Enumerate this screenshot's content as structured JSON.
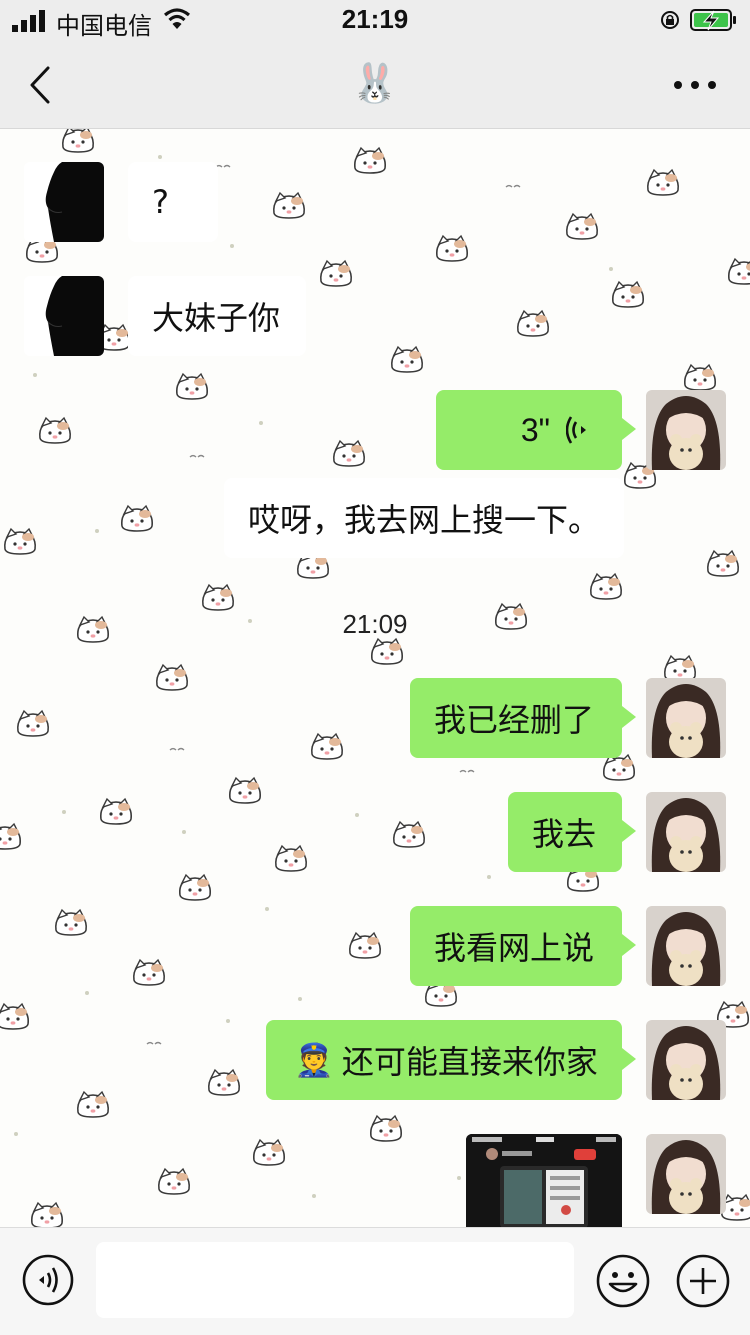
{
  "status_bar": {
    "carrier": "中国电信",
    "time": "21:19"
  },
  "nav": {
    "title": "🐰"
  },
  "messages": {
    "m1": "?",
    "m2": "大妹子你",
    "m3_voice": "3\"",
    "m4": "哎呀，我去网上搜一下。",
    "timestamp": "21:09",
    "m5": "我已经删了",
    "m6": "我去",
    "m7": "我看网上说",
    "m8_emoji": "👮",
    "m8": "还可能直接来你家"
  },
  "colors": {
    "bubble_right": "#95ec69",
    "bar_bg": "#ededed",
    "battery_green": "#3dc34a"
  }
}
